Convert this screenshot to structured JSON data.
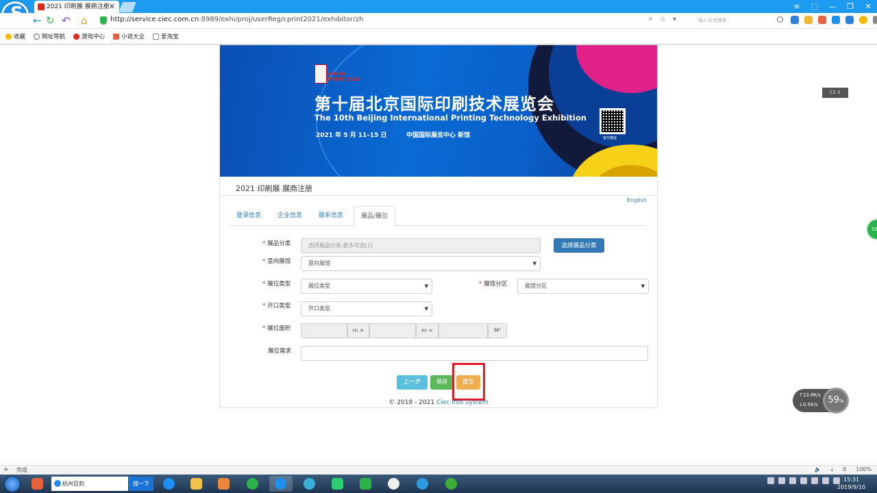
{
  "browser": {
    "tab_title": "2021 印刷展 展商注册",
    "tab_close": "✕",
    "url_host": "http://service.ciec.com.cn",
    "url_path": ":8989/exhi/proj/userReg/cprint2021/exhibitor/zh",
    "search_placeholder": "输入文字搜索",
    "window_controls": [
      "≡",
      "⬚",
      "—",
      "❐",
      "✕"
    ]
  },
  "bookmarks": [
    {
      "label": "收藏",
      "icon": "star-icon",
      "color": "#f5b800"
    },
    {
      "label": "网址导航",
      "icon": "globe-icon",
      "color": "#555555"
    },
    {
      "label": "游戏中心",
      "icon": "game-icon",
      "color": "#e1251b"
    },
    {
      "label": "小说大全",
      "icon": "book-icon",
      "color": "#e8603c"
    },
    {
      "label": "爱淘宝",
      "icon": "page-icon",
      "color": "#888888"
    }
  ],
  "banner": {
    "logo_text_1": "CHINA",
    "logo_text_2": "PRINT 2021",
    "title_cn": "第十届北京国际印刷技术展览会",
    "title_en": "The 10th Beijing International Printing Technology Exhibition",
    "date": "2021 年 5 月 11–15 日",
    "venue": "中国国际展览中心  新馆",
    "qr_caption": "官方微信"
  },
  "page": {
    "title": "2021 印刷展 展商注册",
    "english_link": "English",
    "tabs": [
      {
        "label": "登录信息",
        "active": false
      },
      {
        "label": "企业信息",
        "active": false
      },
      {
        "label": "联系信息",
        "active": false
      },
      {
        "label": "展品/展位",
        "active": true
      }
    ]
  },
  "form": {
    "required_mark": "*",
    "category_label": "展品分类",
    "category_placeholder": "选择展品分类,最多可选[2]",
    "category_button": "选择展品分类",
    "hall_label": "意向展馆",
    "hall_value": "意向展馆",
    "booth_type_label": "展位类型",
    "booth_type_value": "展位类型",
    "zone_label": "展馆分区",
    "zone_value": "展馆分区",
    "opening_label": "开口类型",
    "opening_value": "开口类型",
    "area_label": "展位面积",
    "area_unit_1": "m ×",
    "area_unit_2": "m =",
    "area_unit_3": "M²",
    "need_label": "展位需求",
    "select_arrow": "▼"
  },
  "actions": {
    "prev": "上一步",
    "save": "保存",
    "submit": "提交"
  },
  "footer": {
    "copyright": "© 2018 - 2021",
    "system_name": "Ciec Info System"
  },
  "widgets": {
    "zoom": "13",
    "side_badge": "59",
    "net_up": "13.8",
    "net_down": "0.5",
    "net_unit": "K/s",
    "net_percent": "59",
    "net_percent_unit": "%"
  },
  "status": {
    "text": "完成",
    "right_items": [
      "0",
      "100%"
    ]
  },
  "taskbar": {
    "input_text": "杭州巨豹",
    "search_button": "搜一下",
    "time": "15:31",
    "date": "2019/9/10"
  },
  "colors": {
    "primary_blue": "#337ab7",
    "info": "#5bc0de",
    "success": "#5cb85c",
    "warning": "#f0ad4e",
    "highlight_red": "#e01b24"
  }
}
